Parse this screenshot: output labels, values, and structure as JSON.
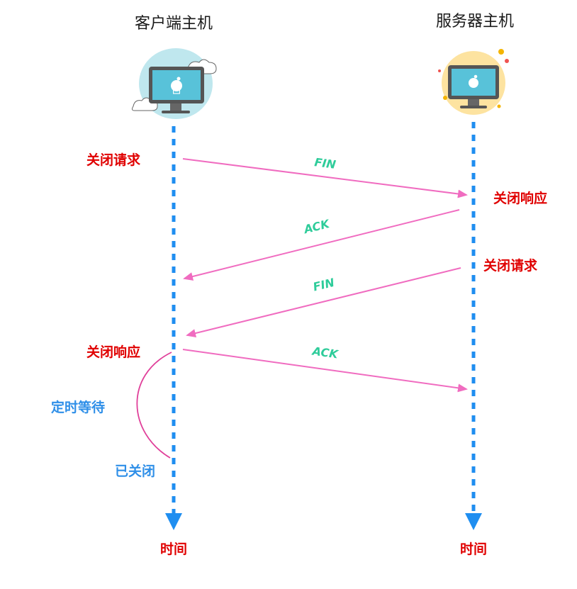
{
  "client": {
    "title": "客户端主机"
  },
  "server": {
    "title": "服务器主机"
  },
  "time_axis": {
    "client_label": "时间",
    "server_label": "时间"
  },
  "messages": [
    {
      "label": "FIN"
    },
    {
      "label": "ACK"
    },
    {
      "label": "FIN"
    },
    {
      "label": "ACK"
    }
  ],
  "events": {
    "client_close_request": "关闭请求",
    "server_close_response": "关闭响应",
    "server_close_request": "关闭请求",
    "client_close_response": "关闭响应",
    "timed_wait": "定时等待",
    "closed": "已关闭"
  },
  "colors": {
    "timeline": "#1f8ef0",
    "arrow": "#f06cc0",
    "message_label": "#2ecc9a",
    "event_label": "#e00000",
    "state_label": "#2f8fe8"
  },
  "icons": {
    "client": "apple-monitor-icon",
    "server": "apple-monitor-icon"
  }
}
